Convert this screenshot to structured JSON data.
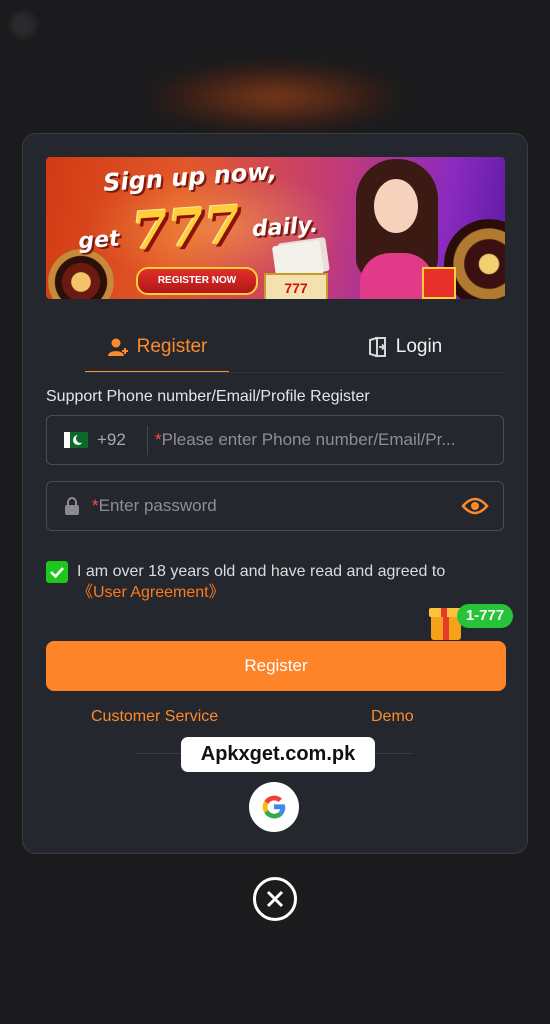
{
  "banner": {
    "line1": "Sign up now,",
    "get": "get",
    "amount": "777",
    "daily": "daily.",
    "cta": "REGISTER NOW",
    "slot": "777"
  },
  "tabs": {
    "register": "Register",
    "login": "Login",
    "active": "register"
  },
  "form": {
    "support_label": "Support Phone number/Email/Profile Register",
    "country_code": "+92",
    "required_mark": "*",
    "phone_placeholder": "Please enter Phone number/Email/Pr...",
    "password_placeholder": "Enter password",
    "agreement_checked": true,
    "agreement_text": "I am over 18 years old and have read and agreed to",
    "agreement_link": "《User Agreement》",
    "bonus_badge": "1-777",
    "register_button": "Register"
  },
  "links": {
    "customer_service": "Customer Service",
    "demo": "Demo"
  },
  "watermark": "Apkxget.com.pk",
  "icons": {
    "register_tab": "add-user-icon",
    "login_tab": "login-door-icon",
    "flag": "pakistan-flag-icon",
    "lock": "lock-icon",
    "eye": "eye-icon",
    "check": "check-icon",
    "gift": "gift-icon",
    "google": "google-icon",
    "close": "close-icon"
  },
  "colors": {
    "accent": "#fd8428",
    "check": "#1ec71e",
    "bonus": "#27c43a",
    "modal_bg": "#25272e"
  }
}
